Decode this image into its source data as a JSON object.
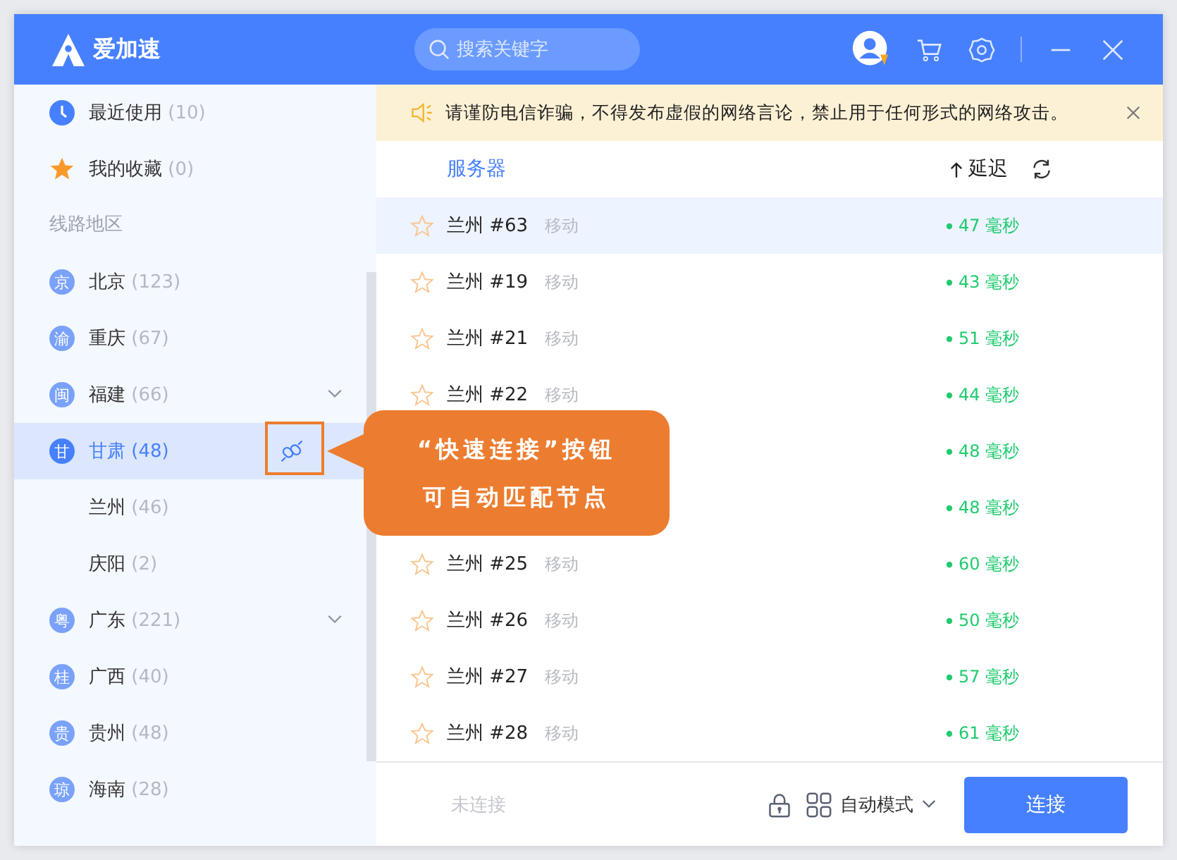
{
  "app": {
    "name": "爱加速"
  },
  "search": {
    "placeholder": "搜索关键字"
  },
  "sidebar": {
    "items": [
      {
        "kind": "recent",
        "label": "最近使用",
        "count": "(10)",
        "selected": false
      },
      {
        "kind": "favorites",
        "label": "我的收藏",
        "count": "(0)",
        "selected": false
      },
      {
        "kind": "section",
        "label": "线路地区"
      },
      {
        "kind": "region",
        "badge": "京",
        "label": "北京",
        "count": "(123)",
        "expandable": false,
        "selected": false
      },
      {
        "kind": "region",
        "badge": "渝",
        "label": "重庆",
        "count": "(67)",
        "expandable": false,
        "selected": false
      },
      {
        "kind": "region",
        "badge": "闽",
        "label": "福建",
        "count": "(66)",
        "expandable": true,
        "selected": false
      },
      {
        "kind": "region",
        "badge": "甘",
        "label": "甘肃",
        "count": "(48)",
        "expandable": false,
        "selected": true
      },
      {
        "kind": "city",
        "label": "兰州",
        "count": "(46)",
        "selected": false
      },
      {
        "kind": "city",
        "label": "庆阳",
        "count": "(2)",
        "selected": false
      },
      {
        "kind": "region",
        "badge": "粤",
        "label": "广东",
        "count": "(221)",
        "expandable": true,
        "selected": false
      },
      {
        "kind": "region",
        "badge": "桂",
        "label": "广西",
        "count": "(40)",
        "expandable": false,
        "selected": false
      },
      {
        "kind": "region",
        "badge": "贵",
        "label": "贵州",
        "count": "(48)",
        "expandable": false,
        "selected": false
      },
      {
        "kind": "region",
        "badge": "琼",
        "label": "海南",
        "count": "(28)",
        "expandable": false,
        "selected": false
      }
    ]
  },
  "notice": {
    "text": "请谨防电信诈骗，不得发布虚假的网络言论，禁止用于任何形式的网络攻击。"
  },
  "table": {
    "columns": [
      "服务器",
      "延迟"
    ],
    "rows": [
      {
        "name": "兰州 #63",
        "carrier": "移动",
        "latency": "47 毫秒",
        "selected": true
      },
      {
        "name": "兰州 #19",
        "carrier": "移动",
        "latency": "43 毫秒",
        "selected": false
      },
      {
        "name": "兰州 #21",
        "carrier": "移动",
        "latency": "51 毫秒",
        "selected": false
      },
      {
        "name": "兰州 #22",
        "carrier": "移动",
        "latency": "44 毫秒",
        "selected": false
      },
      {
        "latency": "48 毫秒",
        "selected": false
      },
      {
        "latency": "48 毫秒",
        "selected": false
      },
      {
        "name": "兰州 #25",
        "carrier": "移动",
        "latency": "60 毫秒",
        "selected": false
      },
      {
        "name": "兰州 #26",
        "carrier": "移动",
        "latency": "50 毫秒",
        "selected": false
      },
      {
        "name": "兰州 #27",
        "carrier": "移动",
        "latency": "57 毫秒",
        "selected": false
      },
      {
        "name": "兰州 #28",
        "carrier": "移动",
        "latency": "61 毫秒",
        "selected": false
      }
    ]
  },
  "callout": {
    "lines": [
      "“快速连接”按钮",
      "可自动匹配节点"
    ]
  },
  "footer": {
    "status": "未连接",
    "mode": "自动模式",
    "connect": "连接"
  }
}
